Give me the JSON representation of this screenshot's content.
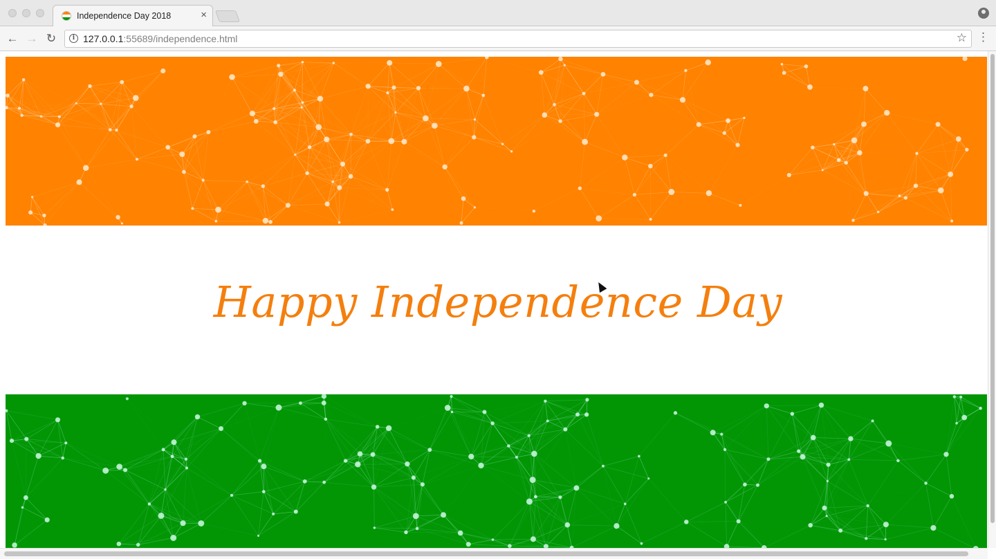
{
  "browser": {
    "tab": {
      "title": "Independence Day 2018",
      "close_glyph": "×"
    },
    "url": {
      "host": "127.0.0.1",
      "path": ":55689/independence.html"
    },
    "nav": {
      "back_glyph": "←",
      "forward_glyph": "→",
      "reload_glyph": "↻",
      "star_glyph": "☆",
      "menu_glyph": "⋮",
      "info_glyph": "i"
    },
    "icons": [
      "back-arrow-icon",
      "forward-arrow-icon",
      "reload-icon",
      "info-icon",
      "bookmark-star-icon",
      "menu-kebab-icon",
      "profile-icon",
      "tricolor-favicon-icon"
    ]
  },
  "page": {
    "headline": "Happy Independence Day",
    "colors": {
      "saffron": "#ff8200",
      "white": "#ffffff",
      "green": "#029605",
      "headline": "#f47f0e"
    }
  }
}
